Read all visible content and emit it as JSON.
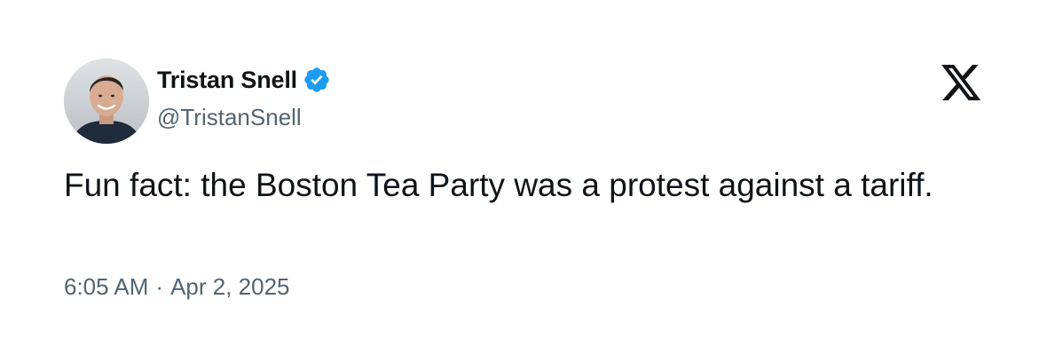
{
  "tweet": {
    "author": {
      "display_name": "Tristan Snell",
      "handle": "@TristanSnell",
      "verified": true,
      "verified_badge_color": "#1d9bf0",
      "avatar_icon": "profile-photo"
    },
    "text": "Fun fact: the Boston Tea Party was a protest against a tariff.",
    "time": "6:05 AM",
    "separator": "·",
    "date": "Apr 2, 2025",
    "brand_icon": "x-logo-icon"
  },
  "colors": {
    "text_primary": "#0f1419",
    "text_secondary": "#536471",
    "background": "#ffffff"
  }
}
